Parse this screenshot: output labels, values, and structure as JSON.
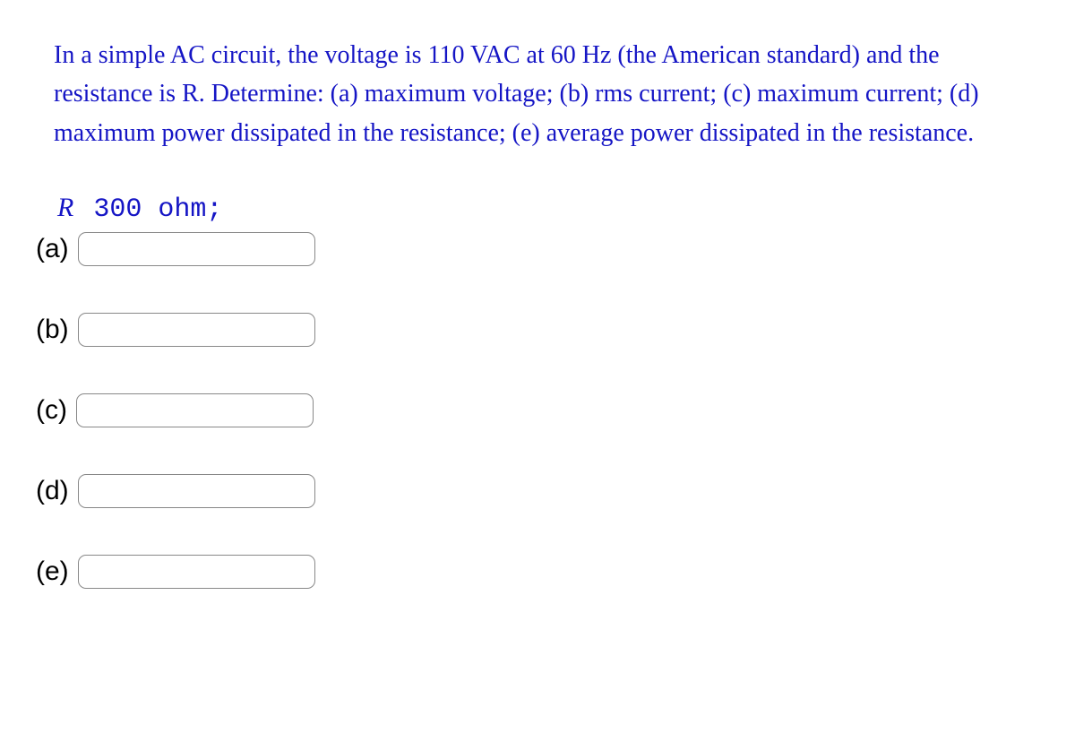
{
  "question": {
    "text": "In a simple AC circuit, the voltage is 110 VAC at 60 Hz (the American standard) and the resistance is R. Determine: (a) maximum voltage; (b) rms current; (c) maximum current; (d) maximum power dissipated in the resistance; (e) average power dissipated in the resistance."
  },
  "resistance": {
    "symbol": "R",
    "value": "300 ohm;"
  },
  "answers": [
    {
      "label": "(a)",
      "value": ""
    },
    {
      "label": "(b)",
      "value": ""
    },
    {
      "label": "(c)",
      "value": ""
    },
    {
      "label": "(d)",
      "value": ""
    },
    {
      "label": "(e)",
      "value": ""
    }
  ]
}
